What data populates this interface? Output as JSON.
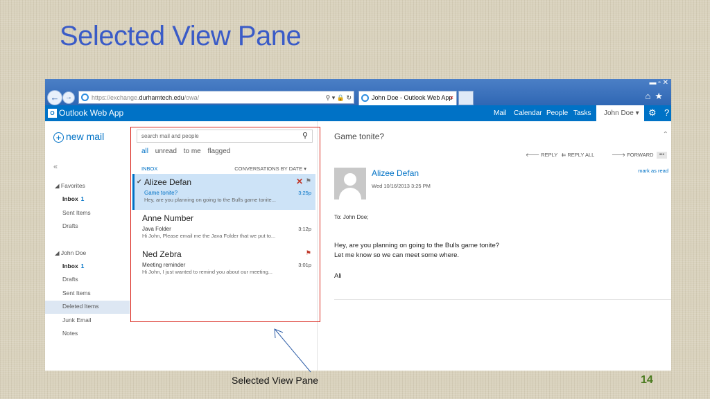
{
  "slide": {
    "title": "Selected View Pane",
    "caption": "Selected View Pane",
    "page_number": "14"
  },
  "browser": {
    "url_prefix": "https://exchange.",
    "url_domain": "durhamtech.edu",
    "url_path": "/owa/",
    "tab_title": "John Doe - Outlook Web App",
    "tab_close": "×"
  },
  "owa": {
    "app_title": "Outlook Web App",
    "logo_letter": "O",
    "nav": [
      "Mail",
      "Calendar",
      "People",
      "Tasks"
    ],
    "user": "John Doe ▾",
    "gear_icon": "⚙",
    "help_icon": "?"
  },
  "folders": {
    "new_mail": "new mail",
    "collapse": "«",
    "favorites_header": "◢ Favorites",
    "favorites": [
      {
        "label": "Inbox",
        "count": "1"
      },
      {
        "label": "Sent Items",
        "count": ""
      },
      {
        "label": "Drafts",
        "count": ""
      }
    ],
    "account_header": "◢ John Doe",
    "account_folders": [
      {
        "label": "Inbox",
        "count": "1"
      },
      {
        "label": "Drafts",
        "count": ""
      },
      {
        "label": "Sent Items",
        "count": ""
      },
      {
        "label": "Deleted Items",
        "count": ""
      },
      {
        "label": "Junk Email",
        "count": ""
      },
      {
        "label": "Notes",
        "count": ""
      }
    ]
  },
  "list": {
    "search_placeholder": "search mail and people",
    "filters": [
      "all",
      "unread",
      "to me",
      "flagged"
    ],
    "inbox_label": "INBOX",
    "sort_label": "CONVERSATIONS BY DATE ▾",
    "messages": [
      {
        "from": "Alizee Defan",
        "subject": "Game tonite?",
        "time": "3:25p",
        "preview": "Hey, are you planning on going to the Bulls game tonite..."
      },
      {
        "from": "Anne Number",
        "subject": "Java Folder",
        "time": "3:12p",
        "preview": "Hi John, Please email me the Java Folder that we put to..."
      },
      {
        "from": "Ned Zebra",
        "subject": "Meeting reminder",
        "time": "3:01p",
        "preview": "Hi John, I just wanted to remind you about our meeting..."
      }
    ]
  },
  "reading": {
    "subject": "Game tonite?",
    "reply": "REPLY",
    "reply_all": "REPLY ALL",
    "forward": "FORWARD",
    "more": "•••",
    "mark_as_read": "mark as read",
    "sender": "Alizee Defan",
    "date": "Wed 10/16/2013 3:25 PM",
    "to": "To:  John Doe;",
    "body_line1": "Hey, are you planning on going to the Bulls game tonite?",
    "body_line2": "Let me know so we can meet some where.",
    "signature": "Ali"
  },
  "colors": {
    "owa_blue": "#0072c6",
    "selection_box": "#d9261c",
    "title_blue": "#3a5bc7",
    "page_number": "#4a7a1e"
  }
}
